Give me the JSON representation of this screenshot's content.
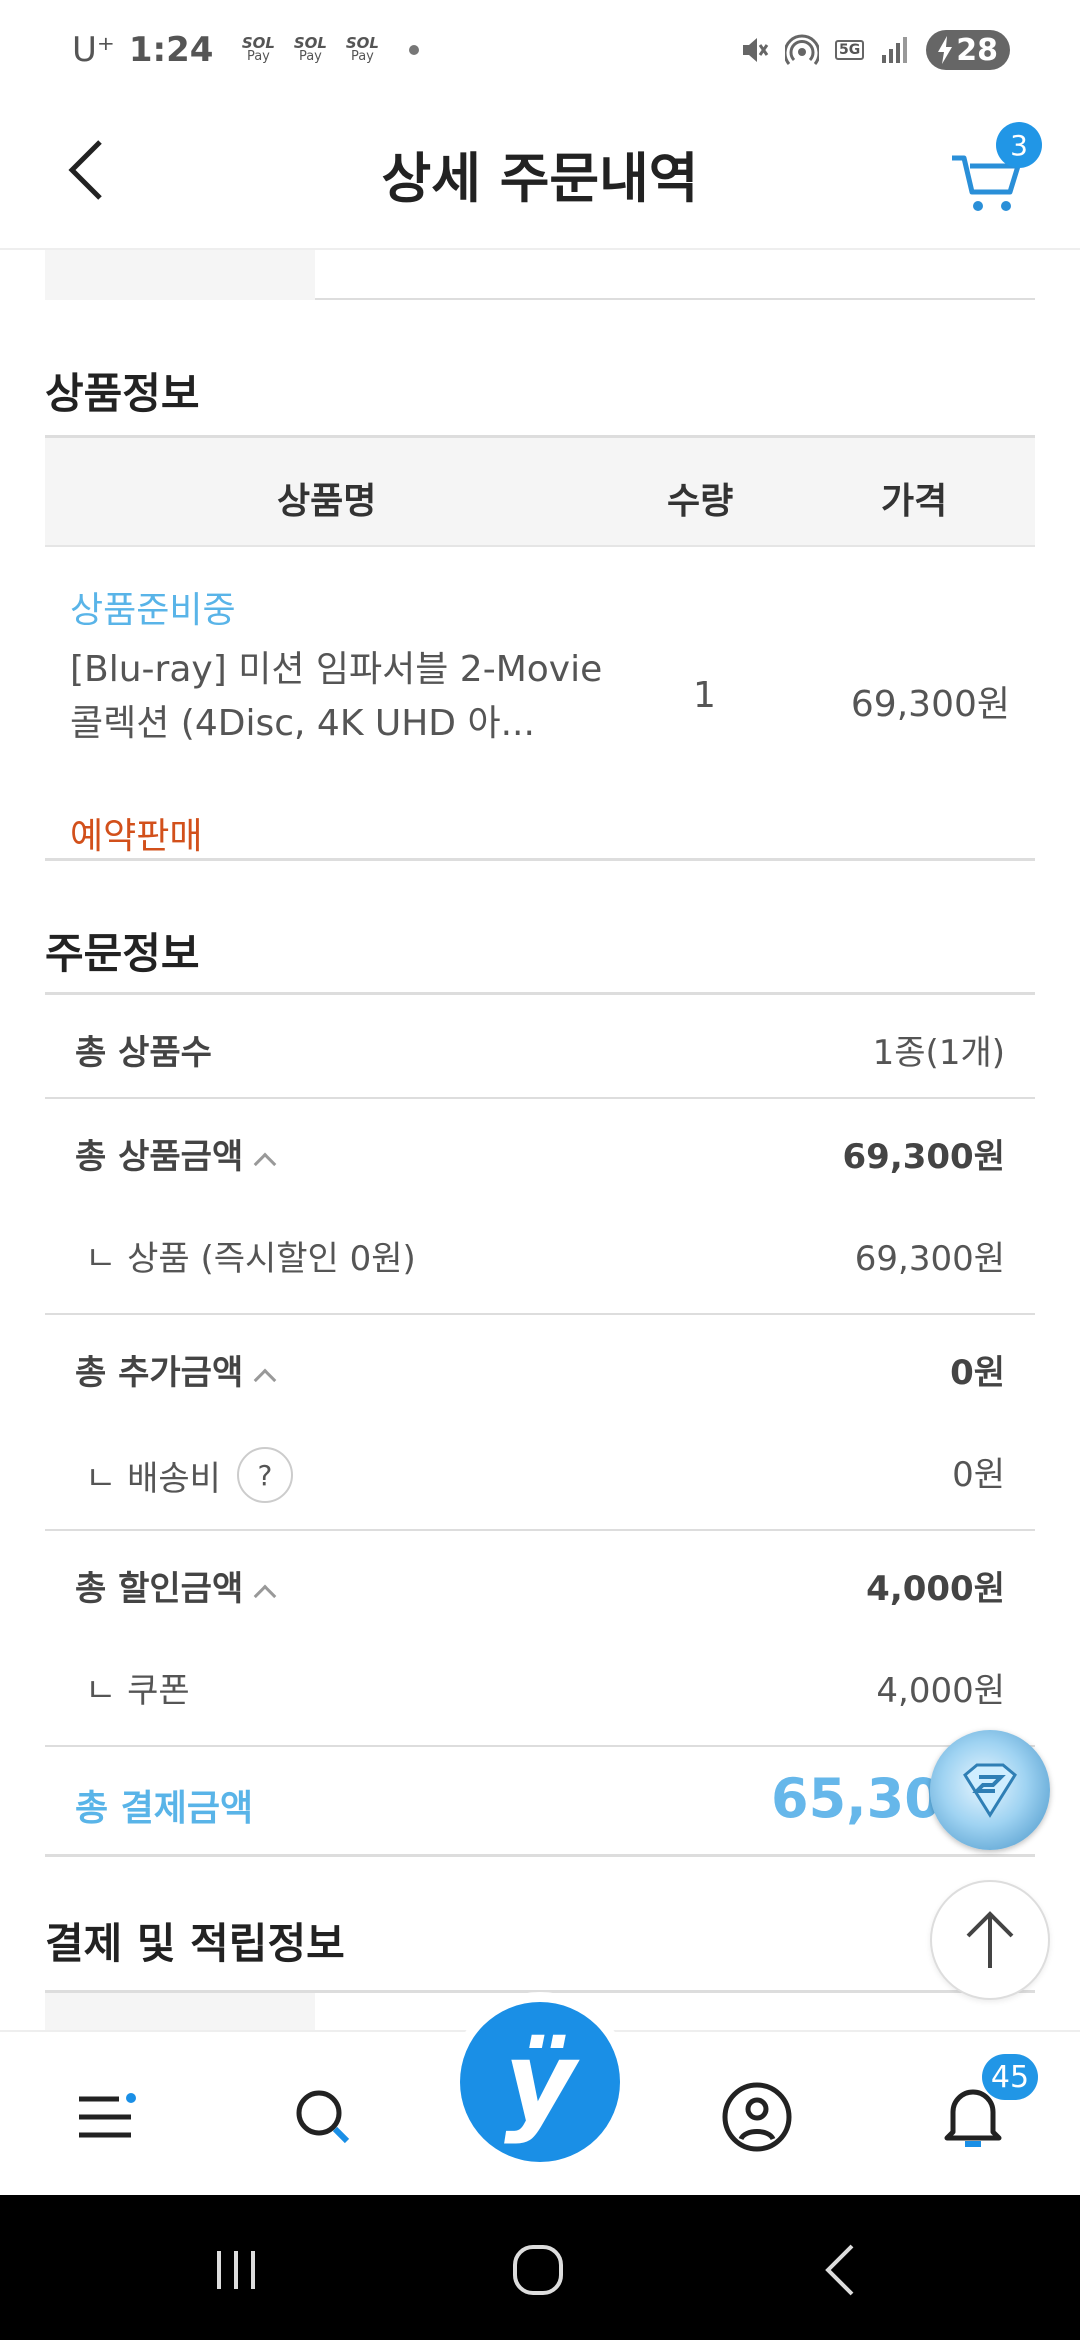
{
  "status_bar": {
    "carrier": "U⁺",
    "time": "1:24",
    "pay_icons": [
      {
        "top": "SOL",
        "bottom": "Pay"
      },
      {
        "top": "SOL",
        "bottom": "Pay"
      },
      {
        "top": "SOL",
        "bottom": "Pay"
      }
    ],
    "network": "5G",
    "battery": "28"
  },
  "header": {
    "title": "상세 주문내역",
    "cart_count": "3"
  },
  "product_section": {
    "title": "상품정보",
    "columns": {
      "name": "상품명",
      "qty": "수량",
      "price": "가격"
    },
    "item": {
      "status": "상품준비중",
      "name": "[Blu-ray] 미션 임파서블 2-Movie 콜렉션 (4Disc, 4K UHD 아...",
      "qty": "1",
      "price": "69,300원",
      "tag": "예약판매"
    }
  },
  "order_section": {
    "title": "주문정보",
    "total_count": {
      "label": "총 상품수",
      "value": "1종(1개)"
    },
    "product_amount": {
      "label": "총 상품금액",
      "value": "69,300원",
      "sub_label": "ㄴ 상품 (즉시할인 0원)",
      "sub_value": "69,300원"
    },
    "extra_amount": {
      "label": "총 추가금액",
      "value": "0원",
      "sub_label": "ㄴ 배송비",
      "sub_value": "0원",
      "help": "?"
    },
    "discount_amount": {
      "label": "총 할인금액",
      "value": "4,000원",
      "sub_label": "ㄴ 쿠폰",
      "sub_value": "4,000원"
    },
    "total_payment": {
      "label": "총 결제금액",
      "value": "65,300"
    }
  },
  "payment_section": {
    "title": "결제 및 적립정보"
  },
  "bottom_nav": {
    "home_logo": "ÿ",
    "notification_count": "45"
  },
  "colors": {
    "accent_blue": "#1a8fe6",
    "light_blue_text": "#59b4e8",
    "reservation_orange": "#d2501b"
  }
}
